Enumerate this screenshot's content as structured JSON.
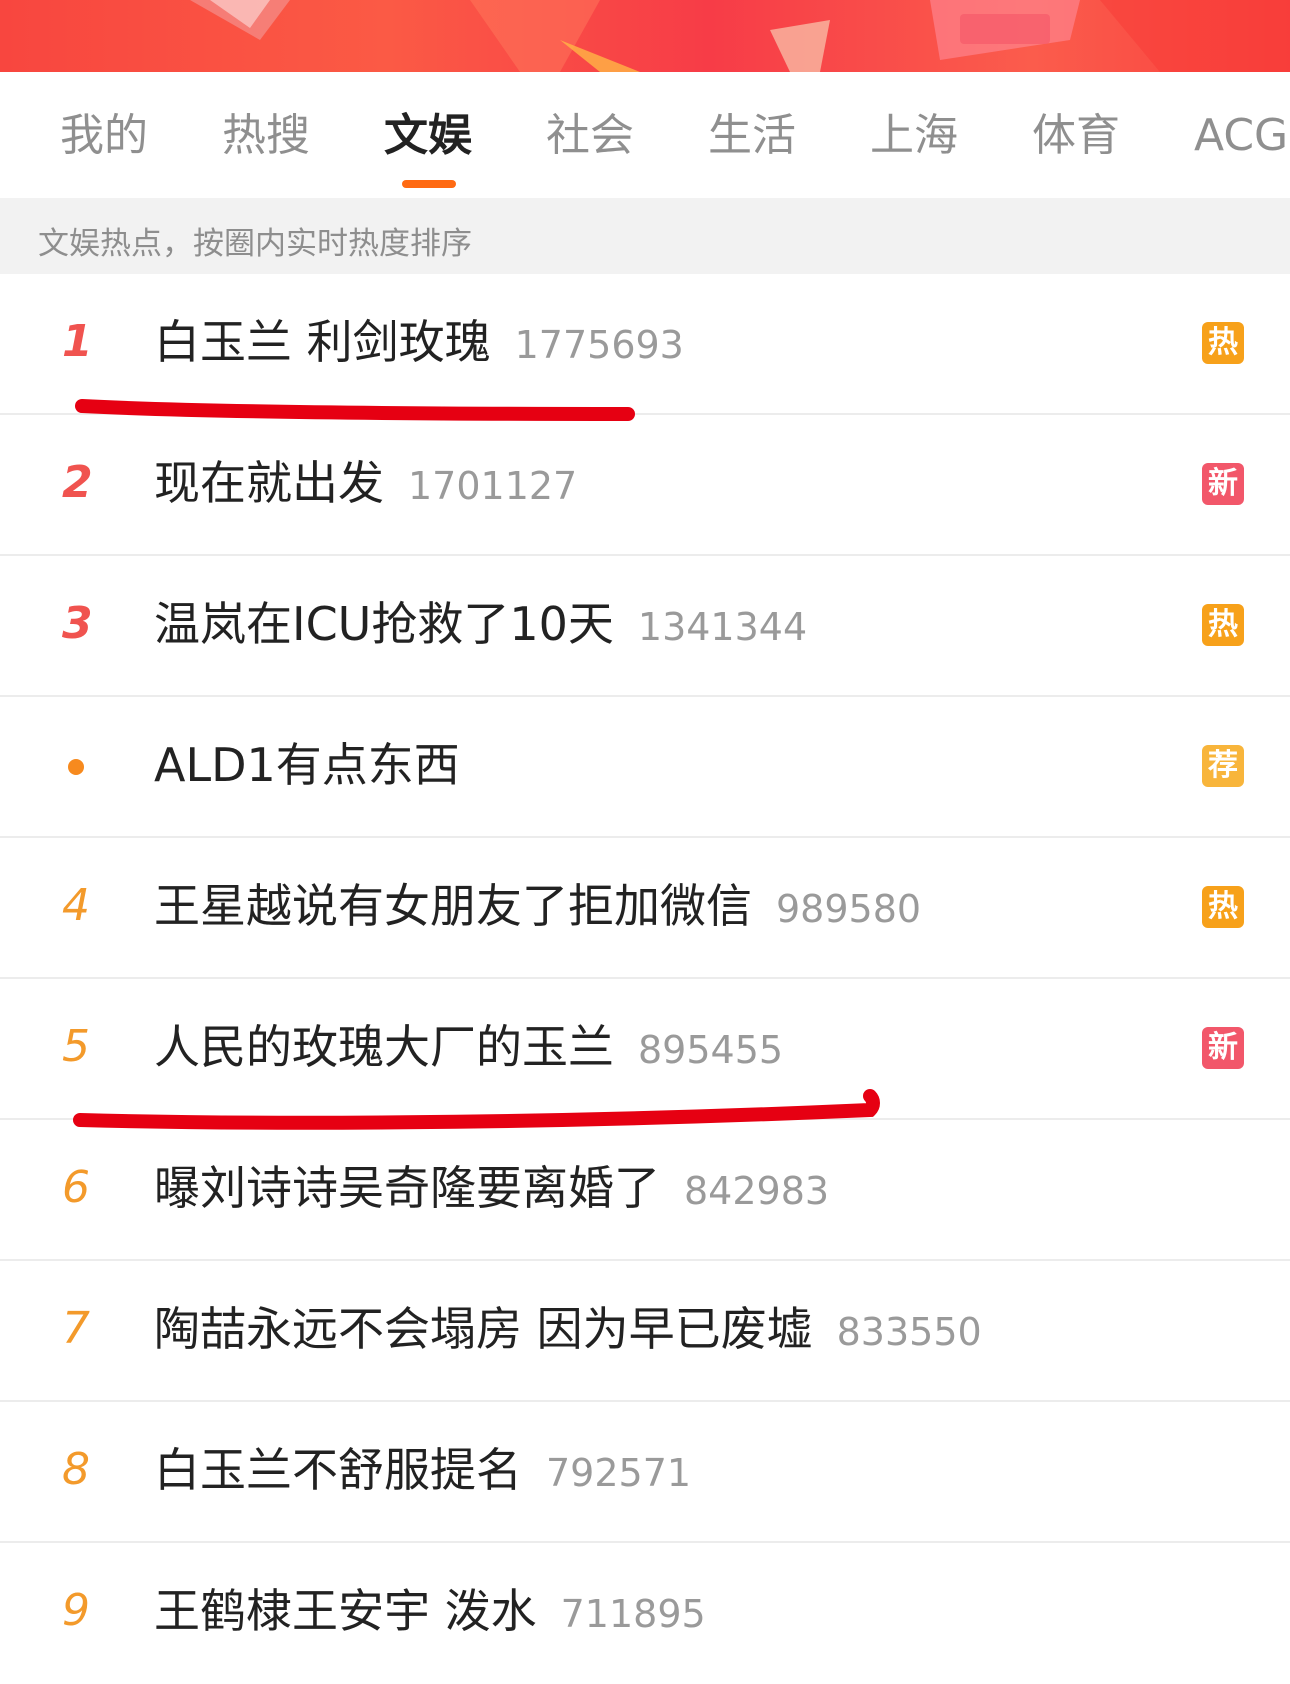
{
  "tabs": [
    {
      "label": "我的"
    },
    {
      "label": "热搜"
    },
    {
      "label": "文娱"
    },
    {
      "label": "社会"
    },
    {
      "label": "生活"
    },
    {
      "label": "上海"
    },
    {
      "label": "体育"
    },
    {
      "label": "ACG"
    }
  ],
  "active_tab": "文娱",
  "subtitle": "文娱热点，按圈内实时热度排序",
  "list": [
    {
      "rank": "1",
      "title": "白玉兰 利剑玫瑰",
      "count": "1775693",
      "badge": "热",
      "badge_color": "#f7a11a"
    },
    {
      "rank": "2",
      "title": "现在就出发",
      "count": "1701127",
      "badge": "新",
      "badge_color": "#f2576a"
    },
    {
      "rank": "3",
      "title": "温岚在ICU抢救了10天",
      "count": "1341344",
      "badge": "热",
      "badge_color": "#f7a11a"
    },
    {
      "rank": "",
      "title": "ALD1有点东西",
      "count": "",
      "badge": "荐",
      "badge_color": "#f8b53b"
    },
    {
      "rank": "4",
      "title": "王星越说有女朋友了拒加微信",
      "count": "989580",
      "badge": "热",
      "badge_color": "#f7a11a"
    },
    {
      "rank": "5",
      "title": "人民的玫瑰大厂的玉兰",
      "count": "895455",
      "badge": "新",
      "badge_color": "#f2576a"
    },
    {
      "rank": "6",
      "title": "曝刘诗诗吴奇隆要离婚了",
      "count": "842983",
      "badge": "",
      "badge_color": ""
    },
    {
      "rank": "7",
      "title": "陶喆永远不会塌房 因为早已废墟",
      "count": "833550",
      "badge": "",
      "badge_color": ""
    },
    {
      "rank": "8",
      "title": "白玉兰不舒服提名",
      "count": "792571",
      "badge": "",
      "badge_color": ""
    },
    {
      "rank": "9",
      "title": "王鹤棣王安宇 泼水",
      "count": "711895",
      "badge": "",
      "badge_color": ""
    }
  ],
  "colors": {
    "accent": "#ff6a12",
    "rank_top": "#f0534f",
    "rank_other": "#f39a2b",
    "annotation_red": "#e60012"
  }
}
